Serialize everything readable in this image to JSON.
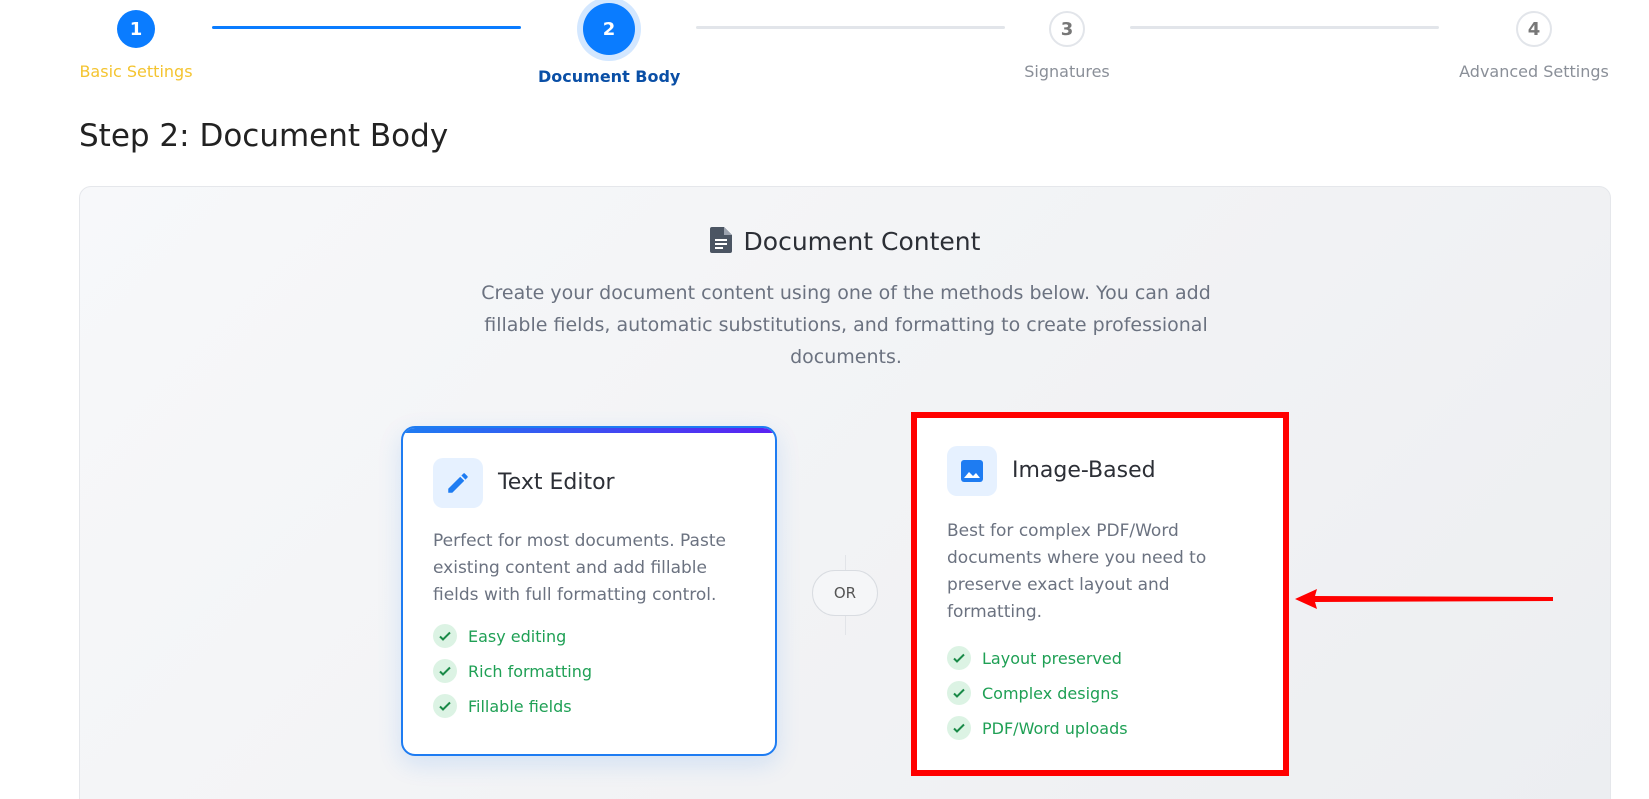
{
  "stepper": {
    "steps": [
      {
        "number": "1",
        "label": "Basic Settings",
        "state": "done"
      },
      {
        "number": "2",
        "label": "Document Body",
        "state": "active"
      },
      {
        "number": "3",
        "label": "Signatures",
        "state": "pending"
      },
      {
        "number": "4",
        "label": "Advanced Settings",
        "state": "pending"
      }
    ],
    "colors": {
      "done_label": "#f4c430",
      "active": "#0a7cff",
      "active_label": "#0a4fa6",
      "pending": "#8a8f98"
    }
  },
  "page_title": "Step 2: Document Body",
  "panel": {
    "heading": "Document Content",
    "heading_icon": "document-icon",
    "description": "Create your document content using one of the methods below. You can add fillable fields, automatic substitutions, and formatting to create professional documents."
  },
  "options": {
    "text_editor": {
      "icon": "pencil-icon",
      "title": "Text Editor",
      "description": "Perfect for most documents. Paste existing content and add fillable fields with full formatting control.",
      "features": [
        "Easy editing",
        "Rich formatting",
        "Fillable fields"
      ]
    },
    "divider_label": "OR",
    "image_based": {
      "icon": "image-icon",
      "title": "Image-Based",
      "description": "Best for complex PDF/Word documents where you need to preserve exact layout and formatting.",
      "features": [
        "Layout preserved",
        "Complex designs",
        "PDF/Word uploads"
      ],
      "highlight_color": "#ff0000"
    }
  },
  "annotation": {
    "arrow_icon": "red-arrow-icon",
    "color": "#ff0000"
  }
}
